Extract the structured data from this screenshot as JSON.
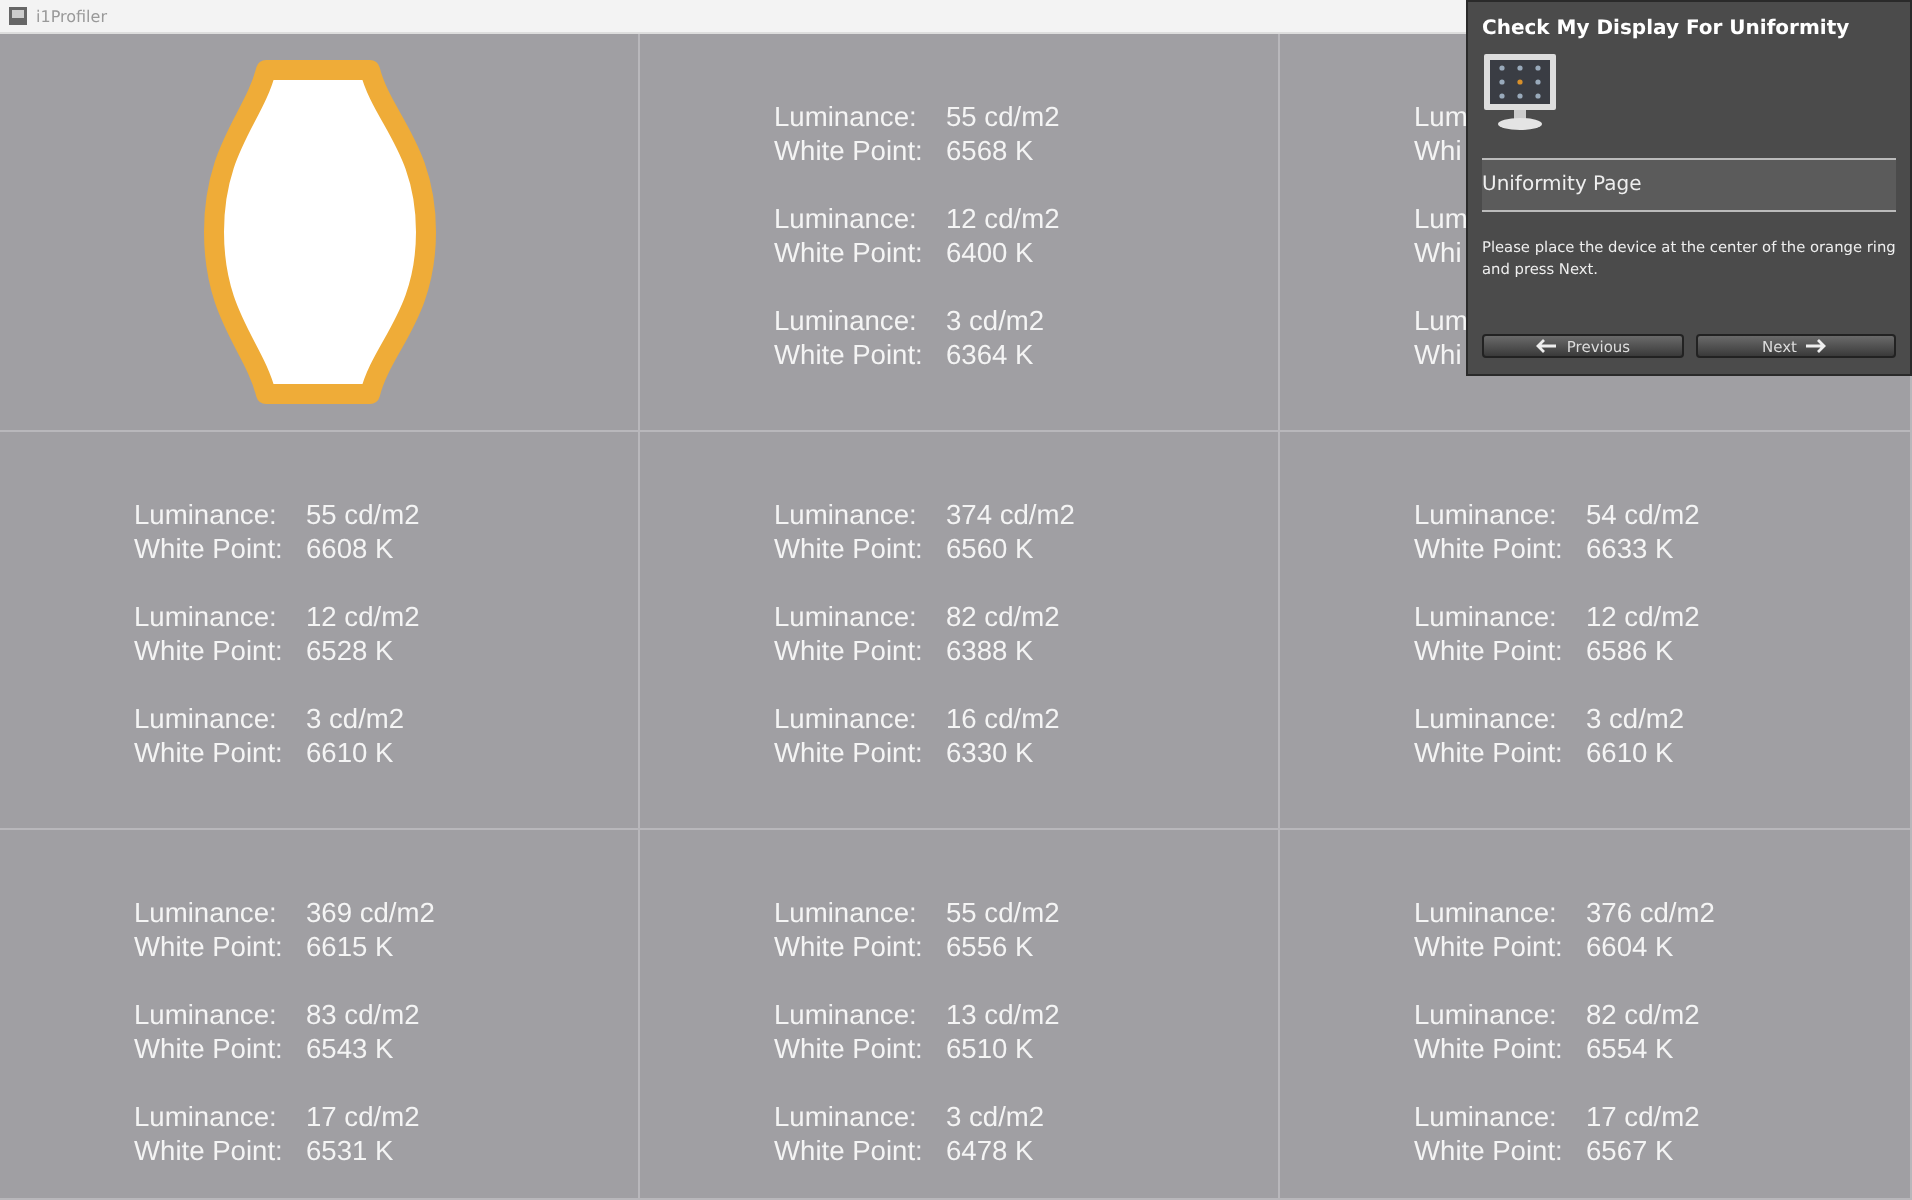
{
  "window": {
    "title": "i1Profiler"
  },
  "cells": [
    {
      "kind": "target"
    },
    {
      "kind": "readings",
      "readings": [
        {
          "luminance_label": "Luminance:",
          "luminance": "55 cd/m2",
          "white_point_label": "White Point:",
          "white_point": "6568 K"
        },
        {
          "luminance_label": "Luminance:",
          "luminance": "12 cd/m2",
          "white_point_label": "White Point:",
          "white_point": "6400 K"
        },
        {
          "luminance_label": "Luminance:",
          "luminance": "3 cd/m2",
          "white_point_label": "White Point:",
          "white_point": "6364 K"
        }
      ]
    },
    {
      "kind": "readings",
      "readings": [
        {
          "luminance_label": "Lum",
          "white_point_label": "Whi"
        },
        {
          "luminance_label": "Lum",
          "white_point_label": "Whi"
        },
        {
          "luminance_label": "Lum",
          "white_point_label": "Whi"
        }
      ]
    },
    {
      "kind": "readings",
      "readings": [
        {
          "luminance_label": "Luminance:",
          "luminance": "55 cd/m2",
          "white_point_label": "White Point:",
          "white_point": "6608 K"
        },
        {
          "luminance_label": "Luminance:",
          "luminance": "12 cd/m2",
          "white_point_label": "White Point:",
          "white_point": "6528 K"
        },
        {
          "luminance_label": "Luminance:",
          "luminance": "3 cd/m2",
          "white_point_label": "White Point:",
          "white_point": "6610 K"
        }
      ]
    },
    {
      "kind": "readings",
      "readings": [
        {
          "luminance_label": "Luminance:",
          "luminance": "374 cd/m2",
          "white_point_label": "White Point:",
          "white_point": "6560 K"
        },
        {
          "luminance_label": "Luminance:",
          "luminance": "82 cd/m2",
          "white_point_label": "White Point:",
          "white_point": "6388 K"
        },
        {
          "luminance_label": "Luminance:",
          "luminance": "16 cd/m2",
          "white_point_label": "White Point:",
          "white_point": "6330 K"
        }
      ]
    },
    {
      "kind": "readings",
      "readings": [
        {
          "luminance_label": "Luminance:",
          "luminance": "54 cd/m2",
          "white_point_label": "White Point:",
          "white_point": "6633 K"
        },
        {
          "luminance_label": "Luminance:",
          "luminance": "12 cd/m2",
          "white_point_label": "White Point:",
          "white_point": "6586 K"
        },
        {
          "luminance_label": "Luminance:",
          "luminance": "3 cd/m2",
          "white_point_label": "White Point:",
          "white_point": "6610 K"
        }
      ]
    },
    {
      "kind": "readings",
      "readings": [
        {
          "luminance_label": "Luminance:",
          "luminance": "369 cd/m2",
          "white_point_label": "White Point:",
          "white_point": "6615 K"
        },
        {
          "luminance_label": "Luminance:",
          "luminance": "83 cd/m2",
          "white_point_label": "White Point:",
          "white_point": "6543 K"
        },
        {
          "luminance_label": "Luminance:",
          "luminance": "17 cd/m2",
          "white_point_label": "White Point:",
          "white_point": "6531 K"
        }
      ]
    },
    {
      "kind": "readings",
      "readings": [
        {
          "luminance_label": "Luminance:",
          "luminance": "55 cd/m2",
          "white_point_label": "White Point:",
          "white_point": "6556 K"
        },
        {
          "luminance_label": "Luminance:",
          "luminance": "13 cd/m2",
          "white_point_label": "White Point:",
          "white_point": "6510 K"
        },
        {
          "luminance_label": "Luminance:",
          "luminance": "3 cd/m2",
          "white_point_label": "White Point:",
          "white_point": "6478 K"
        }
      ]
    },
    {
      "kind": "readings",
      "readings": [
        {
          "luminance_label": "Luminance:",
          "luminance": "376 cd/m2",
          "white_point_label": "White Point:",
          "white_point": "6604 K"
        },
        {
          "luminance_label": "Luminance:",
          "luminance": "82 cd/m2",
          "white_point_label": "White Point:",
          "white_point": "6554 K"
        },
        {
          "luminance_label": "Luminance:",
          "luminance": "17 cd/m2",
          "white_point_label": "White Point:",
          "white_point": "6567 K"
        }
      ]
    }
  ],
  "panel": {
    "title": "Check My Display For Uniformity",
    "page": "Uniformity Page",
    "instructions": "Please place the device at the center of the orange ring and press Next.",
    "buttons": [
      {
        "label": "Previous",
        "kind": "back"
      },
      {
        "label": "Next",
        "kind": "forward"
      }
    ]
  }
}
